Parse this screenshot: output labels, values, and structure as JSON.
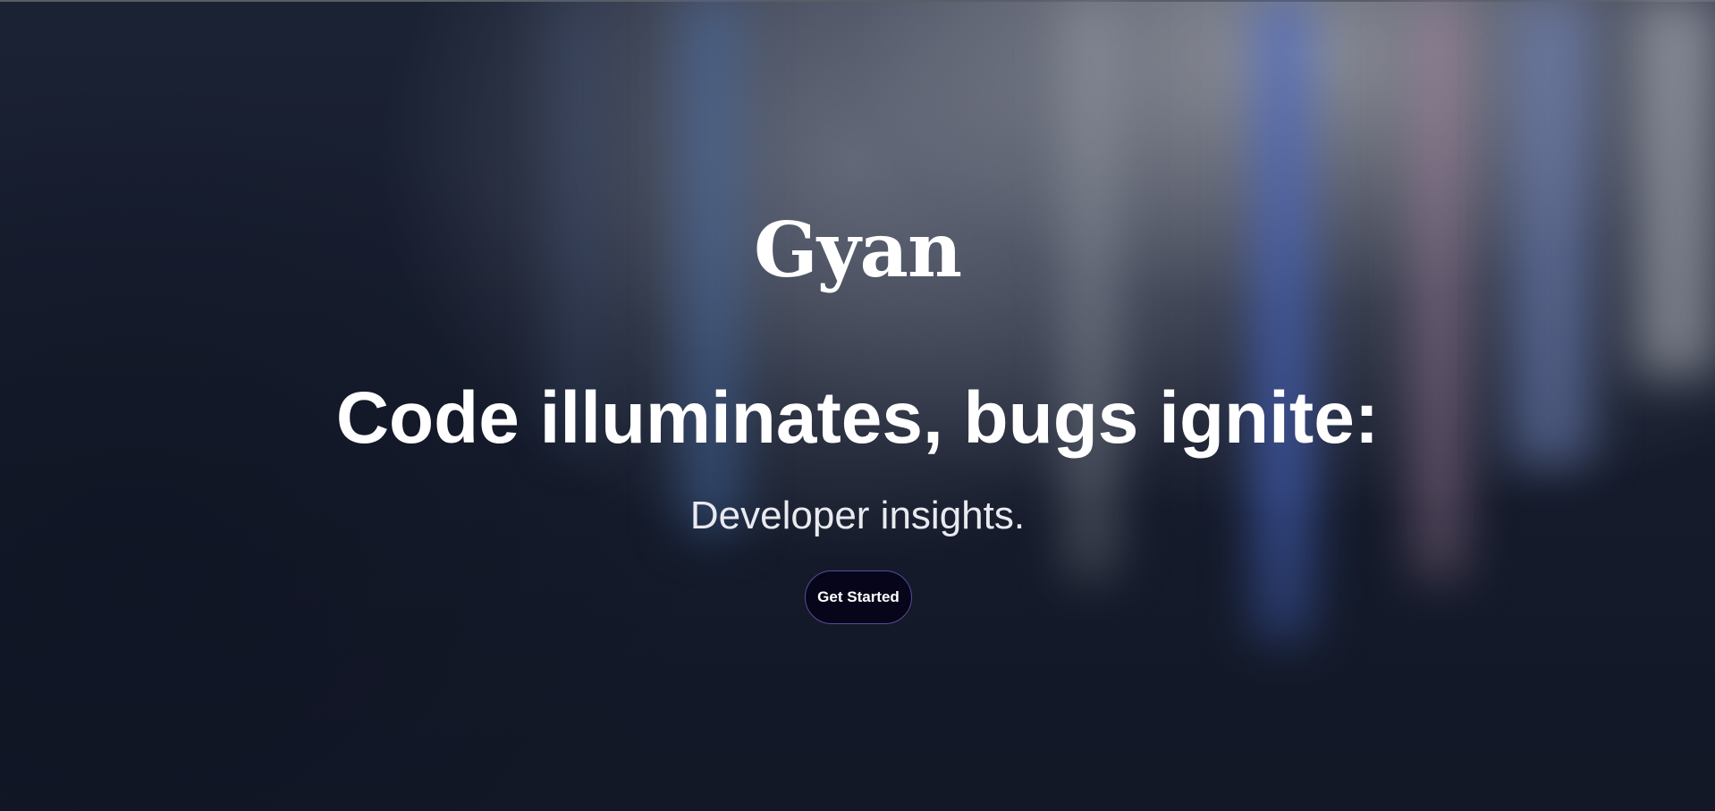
{
  "hero": {
    "brand": "Gyan",
    "headline": "Code illuminates, bugs ignite:",
    "subtitle": "Developer insights.",
    "cta_label": "Get Started"
  },
  "colors": {
    "background_dark": "#141a2a",
    "button_background": "#07051a",
    "button_border": "#5a4a9a",
    "text": "#ffffff"
  }
}
